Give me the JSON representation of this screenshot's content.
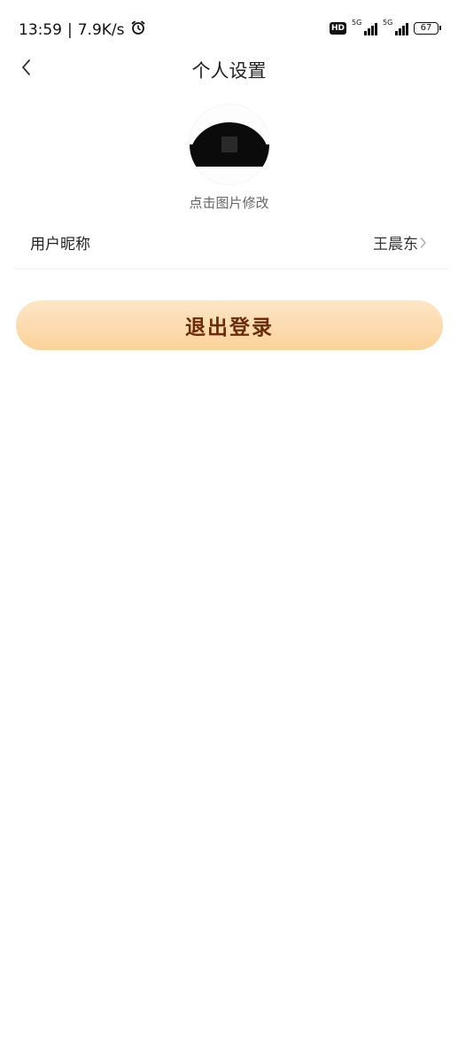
{
  "status_bar": {
    "time": "13:59",
    "net_speed": "7.9K/s",
    "separator": "|",
    "hd_label": "HD",
    "sim1_label": "5G",
    "sim2_label": "5G",
    "battery": "67"
  },
  "nav": {
    "title": "个人设置",
    "back_icon": "chevron-left-icon"
  },
  "profile": {
    "avatar_hint": "点击图片修改"
  },
  "nickname_row": {
    "label": "用户昵称",
    "value": "王晨东",
    "chevron_icon": "chevron-right-icon"
  },
  "logout": {
    "label": "退出登录"
  },
  "colors": {
    "logout_bg_top": "#fde6c6",
    "logout_bg_bottom": "#fbd29a",
    "logout_text": "#6b2c0c"
  }
}
